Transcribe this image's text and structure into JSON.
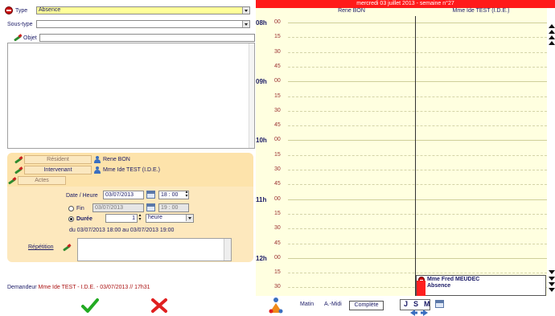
{
  "form": {
    "type_label": "Type",
    "type_value": "Absence",
    "subtype_label": "Sous-type",
    "subtype_value": "",
    "objet_label": "Objet",
    "links": {
      "resident_label": "Résident",
      "resident_value": "Rene BON",
      "intervenant_label": "Intervenant",
      "intervenant_value": "Mme Ide TEST (I.D.E.)",
      "actes_label": "Actes"
    },
    "datetime": {
      "label": "Date / Heure",
      "date": "03/07/2013",
      "time": "18 : 00",
      "fin_label": "Fin",
      "fin_date": "03/07/2013",
      "fin_time": "19 : 00",
      "duree_label": "Durée",
      "duree_value": "1",
      "duree_unit": "heure",
      "range_text": "du  03/07/2013 18:00   au  03/07/2013 19:00",
      "selected_mode": "Durée"
    },
    "repetition_label": "Répétition",
    "demandeur_label": "Demandeur",
    "demandeur_value": "Mme Ide TEST - I.D.E. - 03/07/2013 // 17h31"
  },
  "agenda": {
    "header": "mercredi 03 juillet 2013 - semaine n°27",
    "columns": [
      "Rene BON",
      "Mme Ide TEST (I.D.E.)"
    ],
    "slots": [
      {
        "h": "08h",
        "m": "00"
      },
      {
        "h": "",
        "m": "15"
      },
      {
        "h": "",
        "m": "30"
      },
      {
        "h": "",
        "m": "45"
      },
      {
        "h": "09h",
        "m": "00"
      },
      {
        "h": "",
        "m": "15"
      },
      {
        "h": "",
        "m": "30"
      },
      {
        "h": "",
        "m": "45"
      },
      {
        "h": "10h",
        "m": "00"
      },
      {
        "h": "",
        "m": "15"
      },
      {
        "h": "",
        "m": "30"
      },
      {
        "h": "",
        "m": "45"
      },
      {
        "h": "11h",
        "m": "00"
      },
      {
        "h": "",
        "m": "15"
      },
      {
        "h": "",
        "m": "30"
      },
      {
        "h": "",
        "m": "45"
      },
      {
        "h": "12h",
        "m": "00"
      },
      {
        "h": "",
        "m": "15"
      },
      {
        "h": "",
        "m": "30"
      }
    ],
    "event": {
      "person": "Mme Fred MEUDEC",
      "type": "Absence"
    }
  },
  "toolbar": {
    "matin": "Matin",
    "apres_midi": "A.-Midi",
    "complete": "Complète",
    "view_j": "J",
    "view_s": "S",
    "view_m": "M"
  },
  "colors": {
    "header_red": "#ff1a1a",
    "agenda_bg": "#ffffe0",
    "panel_orange": "#fde3ab",
    "accent_navy": "#1a1a66"
  }
}
